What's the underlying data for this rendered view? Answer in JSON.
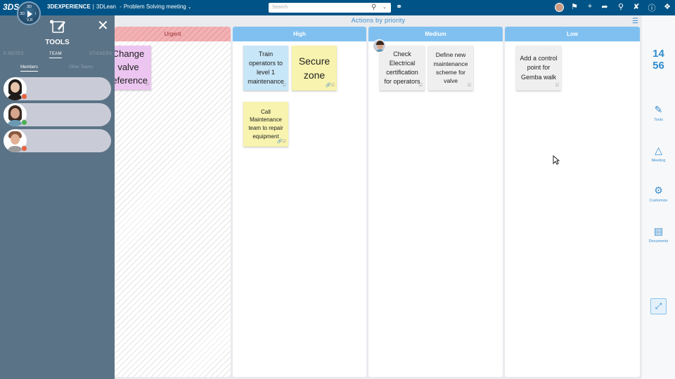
{
  "topbar": {
    "logo": "3DS",
    "compass": {
      "top": "3D",
      "left": "3D",
      "right": "i",
      "bottom": "V,R"
    },
    "brand": "3DEXPERIENCE",
    "separator": "|",
    "app": "3DLean",
    "separator2": "-",
    "document": "Problem Solving meeting",
    "search_placeholder": "Search",
    "icons": [
      "tag-icon",
      "avatar",
      "share-label-icon",
      "add-icon",
      "share-icon",
      "network-icon",
      "tools-icon",
      "help-icon",
      "compass-icon"
    ]
  },
  "board": {
    "title": "Actions by priority",
    "columns": [
      {
        "name": "Urgent"
      },
      {
        "name": "High"
      },
      {
        "name": "Medium"
      },
      {
        "name": "Low"
      }
    ],
    "notes": {
      "urgent_1": "Change valve reference",
      "high_1": "Train operators to level 1 maintenance",
      "high_2": "Secure zone",
      "high_3": "Call Maintenance team to repair equipment",
      "medium_1": "Check Electrical certification for operators",
      "medium_2": "Define new maintenance scheme for valve",
      "low_1": "Add a control point for Gemba walk"
    },
    "note_colors": {
      "pink": "#ecc5f0",
      "blue": "#c7e6f7",
      "yellow": "#f8f3ae",
      "grey": "#efefef"
    }
  },
  "clock": {
    "hours": "14",
    "minutes": "56"
  },
  "rail": {
    "tools": "Tools",
    "meeting": "Meeting",
    "customize": "Customize",
    "documents": "Documents"
  },
  "panel": {
    "title": "TOOLS",
    "tabs": [
      "E-NOTES",
      "TEAM",
      "STICKERS"
    ],
    "subtabs": [
      "Members",
      "Other Teams"
    ],
    "members": [
      {
        "status_color": "#e8623c"
      },
      {
        "status_color": "#4caf50"
      },
      {
        "status_color": "#e8623c"
      }
    ]
  },
  "colors": {
    "accent": "#3c8fd0",
    "topbar": "#005386",
    "panel": "#5b7386",
    "column_head": "#80c0f0"
  }
}
